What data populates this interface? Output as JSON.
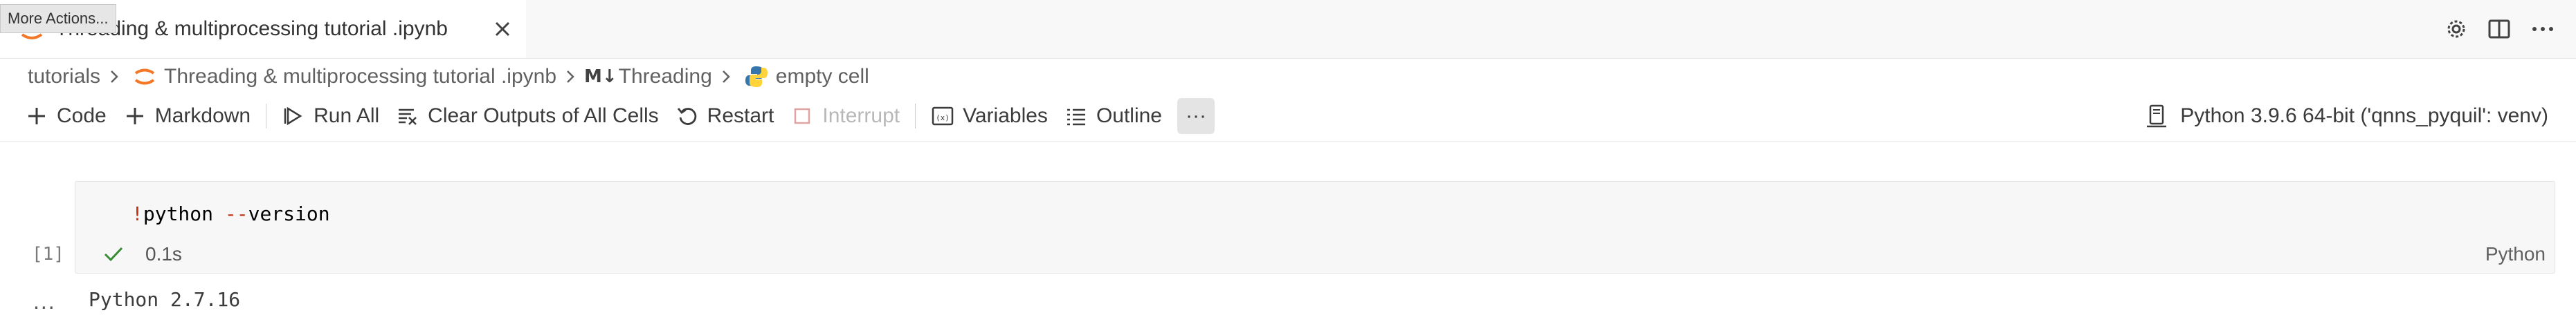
{
  "tab": {
    "title": "Threading & multiprocessing tutorial .ipynb"
  },
  "tooltip": {
    "text": "More Actions..."
  },
  "breadcrumb": {
    "items": [
      "tutorials",
      "Threading & multiprocessing tutorial .ipynb",
      "Threading",
      "empty cell"
    ],
    "md_marker": "M↓"
  },
  "toolbar": {
    "code": "Code",
    "markdown": "Markdown",
    "run_all": "Run All",
    "clear_outputs": "Clear Outputs of All Cells",
    "restart": "Restart",
    "interrupt": "Interrupt",
    "variables": "Variables",
    "outline": "Outline",
    "more": "···"
  },
  "kernel": {
    "label": "Python 3.9.6 64-bit ('qnns_pyquil': venv)"
  },
  "cell": {
    "code_bang": "!",
    "code_cmd": "python ",
    "code_flag_op": "--",
    "code_flag": "version",
    "execution_count": "[1]",
    "duration": "0.1s",
    "language": "Python",
    "output_more": "...",
    "output": "Python 2.7.16"
  },
  "colors": {
    "jupyter_orange": "#f37726",
    "python_blue": "#3776ab",
    "python_yellow": "#ffd43b",
    "success_green": "#388a34"
  }
}
